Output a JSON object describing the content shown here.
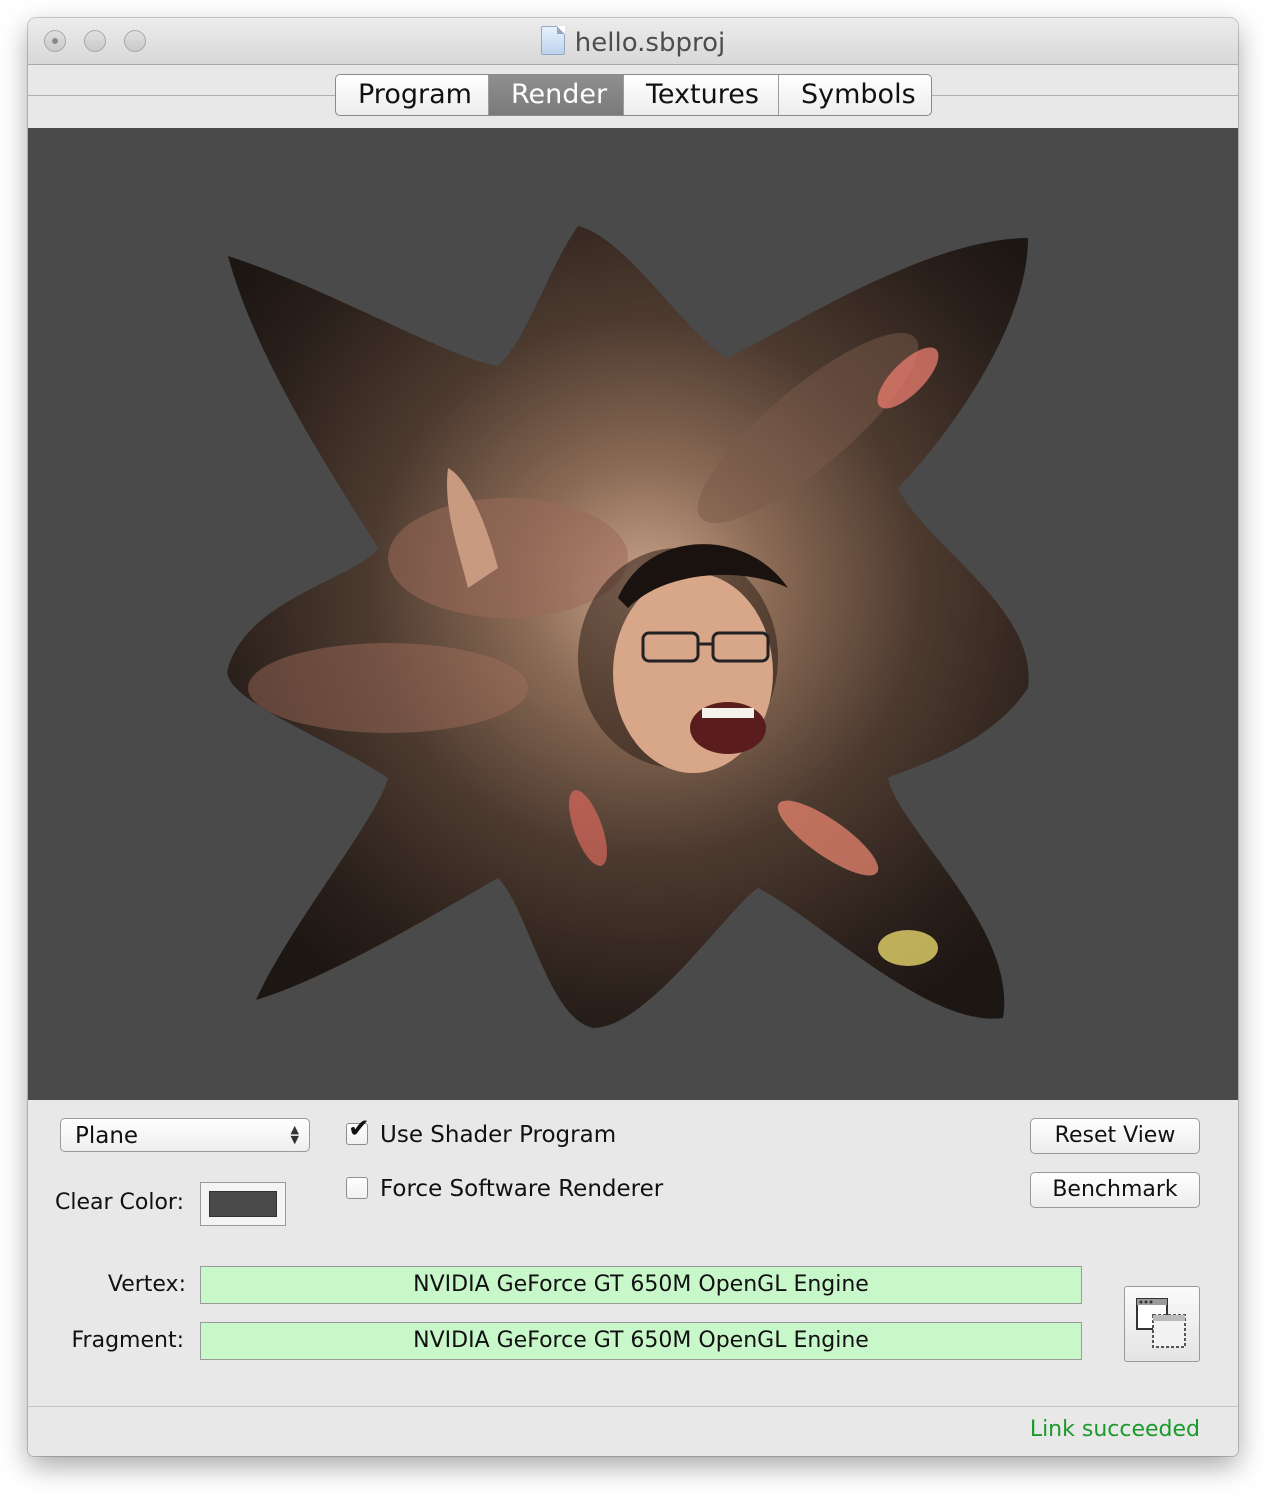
{
  "window": {
    "title": "hello.sbproj"
  },
  "tabs": [
    {
      "label": "Program",
      "active": false
    },
    {
      "label": "Render",
      "active": true
    },
    {
      "label": "Textures",
      "active": false
    },
    {
      "label": "Symbols",
      "active": false
    }
  ],
  "render": {
    "background_color": "#4a4a4a"
  },
  "controls": {
    "geometry_popup": {
      "value": "Plane"
    },
    "use_shader_program": {
      "label": "Use Shader Program",
      "checked": true
    },
    "force_software_renderer": {
      "label": "Force Software Renderer",
      "checked": false
    },
    "reset_view_label": "Reset View",
    "benchmark_label": "Benchmark",
    "clear_color_label": "Clear Color:",
    "clear_color_value": "#4a4a4a",
    "vertex_label": "Vertex:",
    "vertex_value": "NVIDIA GeForce GT 650M OpenGL Engine",
    "fragment_label": "Fragment:",
    "fragment_value": "NVIDIA GeForce GT 650M OpenGL Engine"
  },
  "status": {
    "text": "Link succeeded",
    "color": "#1a9a2a"
  },
  "icons": {
    "document": "document-icon",
    "detach_window": "detach-window-icon"
  }
}
